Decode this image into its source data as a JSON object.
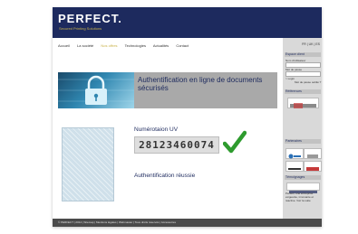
{
  "brand": {
    "name": "PERFECT.",
    "tagline": "Secured Printing Solutions"
  },
  "nav": {
    "items": [
      "Accueil",
      "La société",
      "Nos offres",
      "Technologies",
      "Actualités",
      "Contact"
    ],
    "active_index": 2
  },
  "hero": {
    "title": "Authentification en ligne de documents sécurisés"
  },
  "result": {
    "uv_label": "Numérotaion UV",
    "uv_number": "28123460074",
    "status": "Authentification réussie"
  },
  "sidebar": {
    "lang": "FR | UK | ES",
    "client_header": "Espace client",
    "user_label": "Nom d'utilisateur",
    "pass_label": "Mot de passe",
    "login": "> Login",
    "forgot": "Mot de passe oublié ?",
    "refs_header": "Références",
    "partners_header": "Partenaires",
    "testimonials_header": "Témoignages",
    "testimonial_text": "Perfect, une entreprise exigeante, innovante et réactive. Voir la suite"
  },
  "footer": {
    "text": "© PERFECT | 2014 | Sitemap | Mentions légales | Webmaster | Tous droits réservés | Accessoires"
  },
  "colors": {
    "brand": "#1d2a5e",
    "accent": "#c9b24a",
    "check": "#2e9b2e"
  }
}
